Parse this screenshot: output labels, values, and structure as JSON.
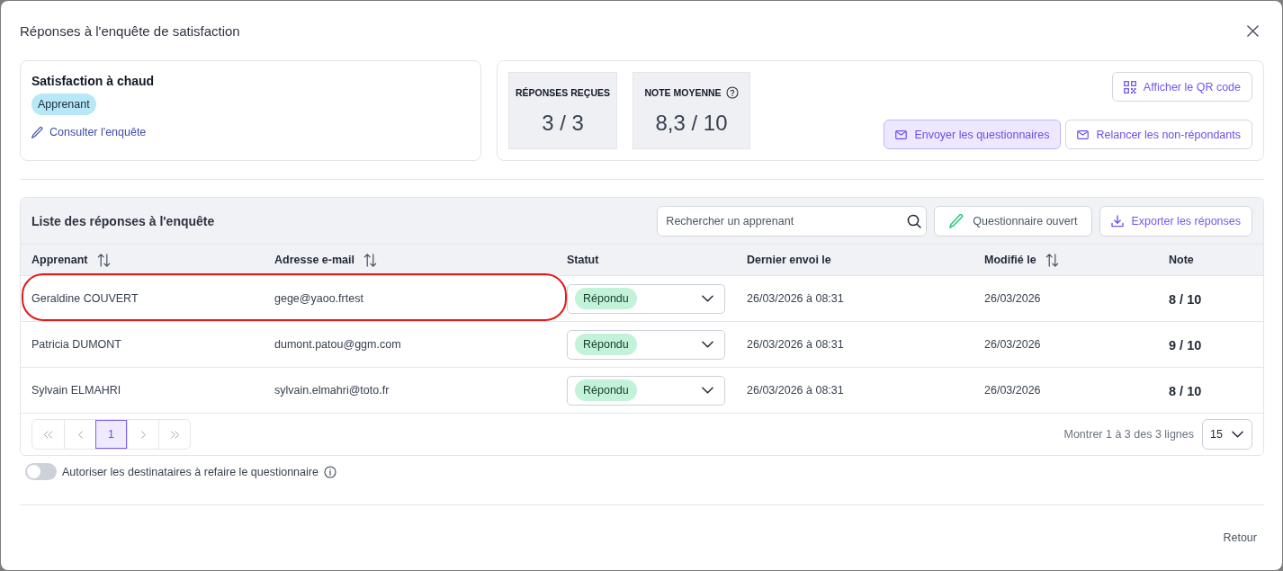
{
  "dialog": {
    "title": "Réponses à l'enquête de satisfaction"
  },
  "survey": {
    "title": "Satisfaction à chaud",
    "tag": "Apprenant",
    "link": "Consulter l'enquête"
  },
  "stats": [
    {
      "label": "RÉPONSES REÇUES",
      "value": "3 / 3",
      "help": false
    },
    {
      "label": "NOTE MOYENNE",
      "value": "8,3 / 10",
      "help": true
    }
  ],
  "qr_button": {
    "label": "Afficher le QR code"
  },
  "send_buttons": [
    {
      "label": "Envoyer les questionnaires",
      "highlighted": true
    },
    {
      "label": "Relancer les non-répondants",
      "highlighted": false
    }
  ],
  "responses": {
    "title": "Liste des réponses à l'enquête",
    "search": {
      "placeholder": "Rechercher un apprenant"
    },
    "open_button": {
      "label": "Questionnaire ouvert"
    },
    "export_button": {
      "label": "Exporter les réponses"
    },
    "columns": [
      {
        "label": "Apprenant",
        "sortable": true
      },
      {
        "label": "Adresse e-mail",
        "sortable": true
      },
      {
        "label": "Statut",
        "sortable": false
      },
      {
        "label": "Dernier envoi le",
        "sortable": false
      },
      {
        "label": "Modifié le",
        "sortable": true
      },
      {
        "label": "Note",
        "sortable": false
      }
    ],
    "rows": [
      {
        "learner": "Geraldine COUVERT",
        "email": "gege@yaoo.frtest",
        "status": "Répondu",
        "last_sent": "26/03/2026 à 08:31",
        "modified": "26/03/2026",
        "score": "8 / 10",
        "annotated": true
      },
      {
        "learner": "Patricia DUMONT",
        "email": "dumont.patou@ggm.com",
        "status": "Répondu",
        "last_sent": "26/03/2026 à 08:31",
        "modified": "26/03/2026",
        "score": "9 / 10",
        "annotated": false
      },
      {
        "learner": "Sylvain ELMAHRI",
        "email": "sylvain.elmahri@toto.fr",
        "status": "Répondu",
        "last_sent": "26/03/2026 à 08:31",
        "modified": "26/03/2026",
        "score": "8 / 10",
        "annotated": false
      }
    ],
    "pagination": {
      "pages": [
        {
          "label": "1",
          "selected": true
        }
      ],
      "summary": "Montrer 1 à 3 des 3 lignes",
      "page_size": "15"
    }
  },
  "retake_toggle": {
    "label": "Autoriser les destinataires à refaire le questionnaire",
    "on": false
  },
  "footer": {
    "back_button": "Retour"
  }
}
